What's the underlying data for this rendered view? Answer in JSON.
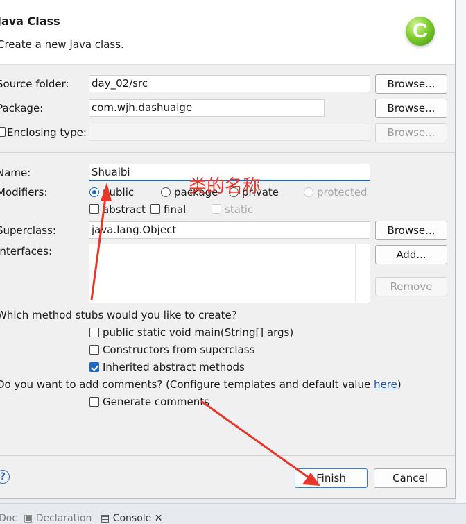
{
  "header": {
    "title": "Java Class",
    "subtitle": "Create a new Java class.",
    "logo_letter": "C"
  },
  "form": {
    "source_folder": {
      "label": "Source folder:",
      "value": "day_02/src",
      "button": "Browse..."
    },
    "package": {
      "label": "Package:",
      "value": "com.wjh.dashuaige",
      "button": "Browse..."
    },
    "enclosing_type": {
      "label": "Enclosing type:",
      "value": "",
      "button": "Browse...",
      "checked": false
    },
    "name": {
      "label": "Name:",
      "value": "Shuaibi"
    },
    "modifiers": {
      "label": "Modifiers:",
      "radios": [
        "public",
        "package",
        "private",
        "protected"
      ],
      "selected": "public",
      "checks": [
        {
          "label": "abstract",
          "checked": false
        },
        {
          "label": "final",
          "checked": false
        },
        {
          "label": "static",
          "checked": false,
          "disabled": true
        }
      ]
    },
    "superclass": {
      "label": "Superclass:",
      "value": "java.lang.Object",
      "button": "Browse..."
    },
    "interfaces": {
      "label": "Interfaces:",
      "add_button": "Add...",
      "remove_button": "Remove"
    },
    "stubs": {
      "question": "Which method stubs would you like to create?",
      "options": [
        {
          "label": "public static void main(String[] args)",
          "checked": false
        },
        {
          "label": "Constructors from superclass",
          "checked": false
        },
        {
          "label": "Inherited abstract methods",
          "checked": true
        }
      ]
    },
    "comments": {
      "question": "Do you want to add comments? (Configure templates and default value ",
      "link": "here",
      "question_end": ")",
      "option": {
        "label": "Generate comments",
        "checked": false
      }
    }
  },
  "footer": {
    "help": "?",
    "finish": "Finish",
    "cancel": "Cancel"
  },
  "annotation": {
    "text": "类的名称",
    "color": "#e8372a"
  },
  "bottom_tabs": {
    "doc": "Doc",
    "declaration": "Declaration",
    "console": "Console",
    "close": "✕"
  }
}
